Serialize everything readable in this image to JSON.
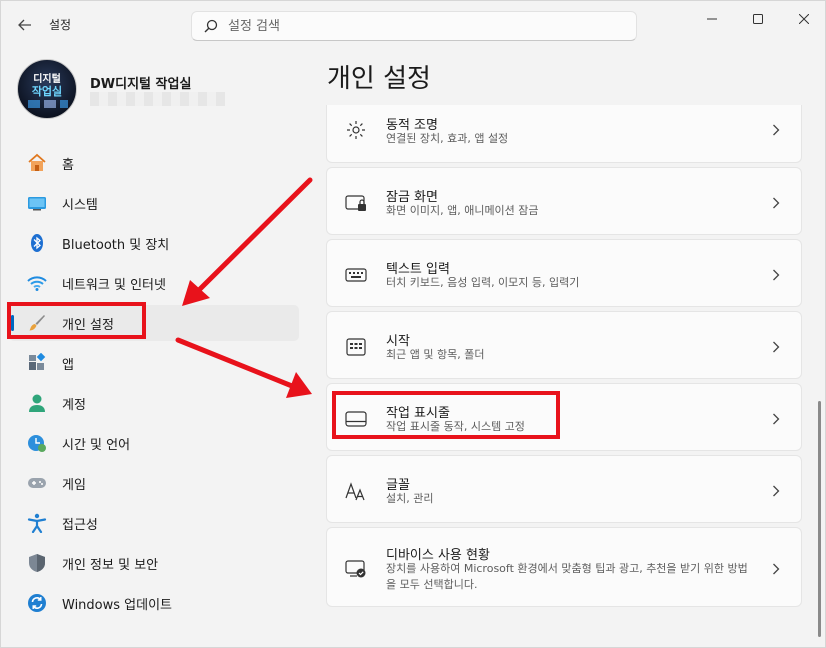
{
  "window": {
    "app_title": "설정"
  },
  "search": {
    "placeholder": "설정 검색"
  },
  "profile": {
    "name": "DW디지털 작업실",
    "email": "",
    "avatar_line1": "디지털",
    "avatar_line2": "작업실"
  },
  "sidebar": {
    "items": [
      {
        "label": "홈",
        "icon": "home-icon"
      },
      {
        "label": "시스템",
        "icon": "system-icon"
      },
      {
        "label": "Bluetooth 및 장치",
        "icon": "bluetooth-icon"
      },
      {
        "label": "네트워크 및 인터넷",
        "icon": "network-icon"
      },
      {
        "label": "개인 설정",
        "icon": "brush-icon",
        "selected": true
      },
      {
        "label": "앱",
        "icon": "apps-icon"
      },
      {
        "label": "계정",
        "icon": "account-icon"
      },
      {
        "label": "시간 및 언어",
        "icon": "clock-globe-icon"
      },
      {
        "label": "게임",
        "icon": "gamepad-icon"
      },
      {
        "label": "접근성",
        "icon": "accessibility-icon"
      },
      {
        "label": "개인 정보 및 보안",
        "icon": "shield-icon"
      },
      {
        "label": "Windows 업데이트",
        "icon": "update-icon"
      }
    ]
  },
  "main": {
    "title": "개인 설정",
    "cards": [
      {
        "title": "동적 조명",
        "subtitle": "연결된 장치, 효과, 앱 설정",
        "icon": "dynamic-lighting-icon"
      },
      {
        "title": "잠금 화면",
        "subtitle": "화면 이미지, 앱, 애니메이션 잠금",
        "icon": "lock-screen-icon"
      },
      {
        "title": "텍스트 입력",
        "subtitle": "터치 키보드, 음성 입력, 이모지 등, 입력기",
        "icon": "keyboard-icon"
      },
      {
        "title": "시작",
        "subtitle": "최근 앱 및 항목, 폴더",
        "icon": "start-icon"
      },
      {
        "title": "작업 표시줄",
        "subtitle": "작업 표시줄 동작, 시스템 고정",
        "icon": "taskbar-icon"
      },
      {
        "title": "글꼴",
        "subtitle": "설치, 관리",
        "icon": "fonts-icon"
      },
      {
        "title": "디바이스 사용 현황",
        "subtitle": "장치를 사용하여 Microsoft 환경에서 맞춤형 팁과 광고, 추천을 받기 위한 방법을 모두 선택합니다.",
        "icon": "device-usage-icon"
      }
    ]
  },
  "colors": {
    "accent": "#0067c0",
    "annotation": "#e8121b",
    "background": "#f3f3f3",
    "card": "#fbfbfb"
  }
}
